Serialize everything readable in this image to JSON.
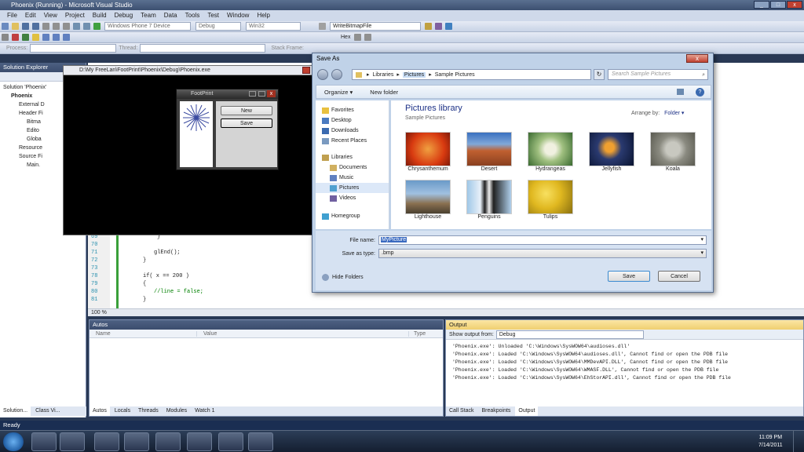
{
  "window": {
    "title": "Phoenix (Running) - Microsoft Visual Studio"
  },
  "menu": [
    "File",
    "Edit",
    "View",
    "Project",
    "Build",
    "Debug",
    "Team",
    "Data",
    "Tools",
    "Test",
    "Window",
    "Help"
  ],
  "toolbar": {
    "platform_device": "Windows Phone 7 Device",
    "config": "Debug",
    "platform": "Win32",
    "find_combo": "WriteBitmapFile",
    "process_label": "Process:",
    "thread_label": "Thread:",
    "stack_frame_label": "Stack Frame:",
    "hex_label": "Hex"
  },
  "solution_explorer": {
    "title": "Solution Explorer",
    "items": [
      {
        "label": "Solution 'Phoenix'",
        "level": 0
      },
      {
        "label": "Phoenix",
        "level": 1
      },
      {
        "label": "External D",
        "level": 2
      },
      {
        "label": "Header Fi",
        "level": 2
      },
      {
        "label": "Bitma",
        "level": 3
      },
      {
        "label": "Edito",
        "level": 3
      },
      {
        "label": "Globa",
        "level": 3
      },
      {
        "label": "Resource",
        "level": 2
      },
      {
        "label": "Source Fi",
        "level": 2
      },
      {
        "label": "Main.",
        "level": 3
      }
    ]
  },
  "console": {
    "title": "D:\\My FreeLan\\FootPrint\\Phoenix\\Debug\\Phoenix.exe"
  },
  "footprint": {
    "title": "FootPrint",
    "new_button": "New",
    "save_button": "Save"
  },
  "editor": {
    "zoom": "100 %",
    "lines": [
      {
        "num": "69",
        "text": "}"
      },
      {
        "num": "70",
        "text": ""
      },
      {
        "num": "71",
        "text": "glEnd();"
      },
      {
        "num": "72",
        "text": "}"
      },
      {
        "num": "73",
        "text": ""
      },
      {
        "num": "78",
        "text": "if( x == 200 )"
      },
      {
        "num": "79",
        "text": "{"
      },
      {
        "num": "80",
        "text": "//line = false;"
      },
      {
        "num": "81",
        "text": "}"
      }
    ]
  },
  "save_dialog": {
    "title": "Save As",
    "breadcrumb": [
      "Libraries",
      "Pictures",
      "Sample Pictures"
    ],
    "search_placeholder": "Search Sample Pictures",
    "organize": "Organize",
    "new_folder": "New folder",
    "library_title": "Pictures library",
    "library_subtitle": "Sample Pictures",
    "arrange_label": "Arrange by:",
    "arrange_value": "Folder",
    "nav": {
      "favorites": "Favorites",
      "desktop": "Desktop",
      "downloads": "Downloads",
      "recent": "Recent Places",
      "libraries": "Libraries",
      "documents": "Documents",
      "music": "Music",
      "pictures": "Pictures",
      "videos": "Videos",
      "homegroup": "Homegroup"
    },
    "thumbnails": [
      {
        "name": "Chrysanthemum",
        "color": "#d83a10"
      },
      {
        "name": "Desert",
        "color": "#b55a2a"
      },
      {
        "name": "Hydrangeas",
        "color": "#6aa050"
      },
      {
        "name": "Jellyfish",
        "color": "#1c3050"
      },
      {
        "name": "Koala",
        "color": "#8a8a80"
      },
      {
        "name": "Lighthouse",
        "color": "#5a7a9a"
      },
      {
        "name": "Penguins",
        "color": "#8ab0d0"
      },
      {
        "name": "Tulips",
        "color": "#e0b820"
      }
    ],
    "file_name_label": "File name:",
    "file_name_value": "MyPicture",
    "save_type_label": "Save as type:",
    "save_type_value": ".bmp",
    "hide_folders": "Hide Folders",
    "save_button": "Save",
    "cancel_button": "Cancel"
  },
  "autos": {
    "title": "Autos",
    "columns": [
      "Name",
      "Value",
      "Type"
    ],
    "tabs": [
      "Autos",
      "Locals",
      "Threads",
      "Modules",
      "Watch 1"
    ]
  },
  "output": {
    "title": "Output",
    "show_from_label": "Show output from:",
    "show_from_value": "Debug",
    "lines": [
      "'Phoenix.exe': Unloaded 'C:\\Windows\\SysWOW64\\audioses.dll'",
      "'Phoenix.exe': Loaded 'C:\\Windows\\SysWOW64\\audioses.dll', Cannot find or open the PDB file",
      "'Phoenix.exe': Loaded 'C:\\Windows\\SysWOW64\\MMDevAPI.DLL', Cannot find or open the PDB file",
      "'Phoenix.exe': Loaded 'C:\\Windows\\SysWOW64\\WMASF.DLL', Cannot find or open the PDB file",
      "'Phoenix.exe': Loaded 'C:\\Windows\\SysWOW64\\EhStorAPI.dll', Cannot find or open the PDB file"
    ],
    "tabs": [
      "Call Stack",
      "Breakpoints",
      "Output"
    ]
  },
  "solution_tabs": [
    "Solution...",
    "Class Vi..."
  ],
  "status": {
    "text": "Ready"
  },
  "taskbar": {
    "time": "11:09 PM",
    "date": "7/14/2011"
  }
}
